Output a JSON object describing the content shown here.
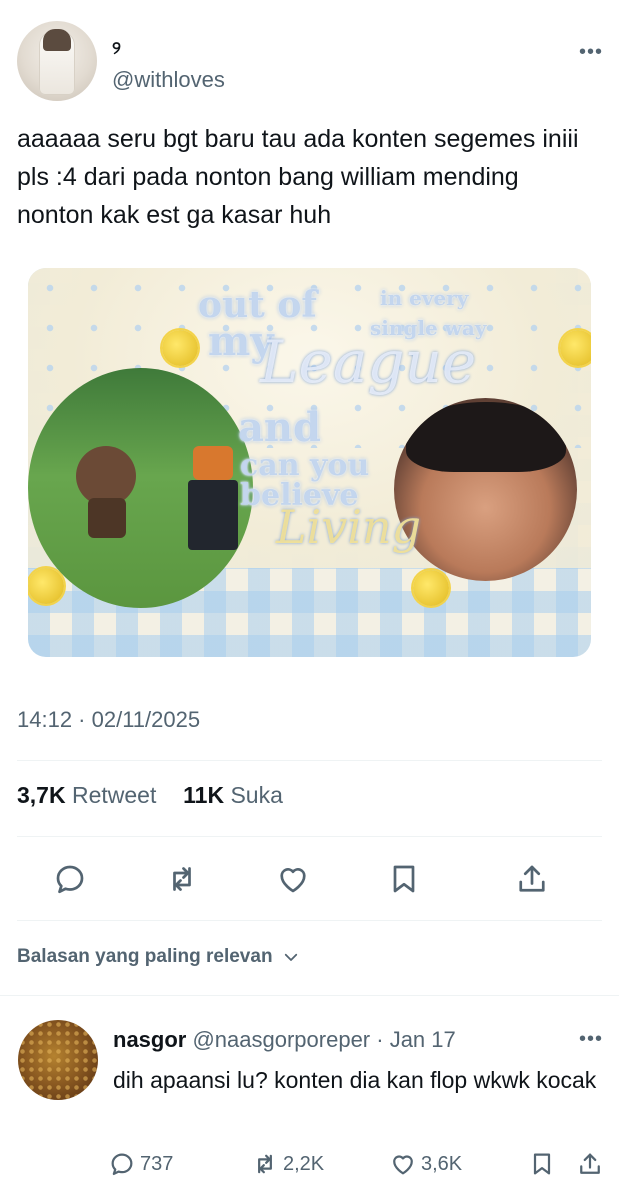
{
  "post": {
    "display_name": "୨",
    "handle": "@withloves",
    "more_label": "•••",
    "text": "aaaaaa seru bgt baru tau ada konten segemes iniii pls :4 dari pada nonton bang william mending nonton kak est ga kasar huh",
    "media": {
      "artwork_text": {
        "line1": "out of",
        "line2": "my",
        "script1": "League",
        "line3": "and",
        "line4": "can you",
        "line5": "believe",
        "script2": "Living",
        "corner1": "in every",
        "corner2": "single way"
      }
    },
    "timestamp": "14:12 · 02/11/2025",
    "stats": {
      "retweets_count": "3,7K",
      "retweets_label": "Retweet",
      "likes_count": "11K",
      "likes_label": "Suka"
    },
    "actions": [
      "reply-icon",
      "retweet-icon",
      "like-icon",
      "bookmark-icon",
      "share-icon"
    ]
  },
  "replies_filter": {
    "label": "Balasan yang paling relevan"
  },
  "reply": {
    "name": "nasgor",
    "meta": " @naasgorporeper · Jan 17",
    "more_label": "•••",
    "text": "dih apaansi lu? konten dia kan flop wkwk kocak",
    "reply_count": "737",
    "retweet_count": "2,2K",
    "like_count": "3,6K"
  },
  "colors": {
    "text_primary": "#0f1419",
    "text_secondary": "#536471",
    "divider": "#eff3f4"
  }
}
